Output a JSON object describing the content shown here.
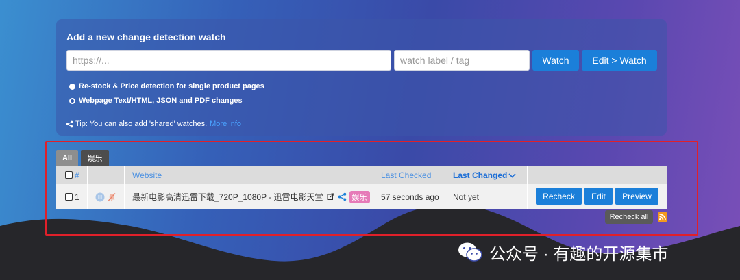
{
  "form": {
    "title": "Add a new change detection watch",
    "url_placeholder": "https://...",
    "tag_placeholder": "watch label / tag",
    "watch_label": "Watch",
    "edit_watch_label": "Edit > Watch",
    "radio_options": [
      "Re-stock & Price detection for single product pages",
      "Webpage Text/HTML, JSON and PDF changes"
    ],
    "selected_option": "Webpage Text/HTML, JSON and PDF changes",
    "tip_text": "Tip: You can also add 'shared' watches.",
    "tip_link": "More info"
  },
  "tabs": [
    "All",
    "娱乐"
  ],
  "table": {
    "columns": {
      "number": "#",
      "website": "Website",
      "last_checked": "Last Checked",
      "last_changed": "Last Changed"
    },
    "rows": [
      {
        "number": "1",
        "website": "最新电影高清迅雷下载_720P_1080P - 迅雷电影天堂",
        "tag": "娱乐",
        "last_checked": "57 seconds ago",
        "last_changed": "Not yet",
        "actions": [
          "Recheck",
          "Edit",
          "Preview"
        ]
      }
    ]
  },
  "recheck_all": "Recheck all",
  "watermark": "公众号 · 有趣的开源集市",
  "colors": {
    "accent": "#1b7fd9",
    "tag": "#e67bb8",
    "highlight": "#e0202a"
  }
}
